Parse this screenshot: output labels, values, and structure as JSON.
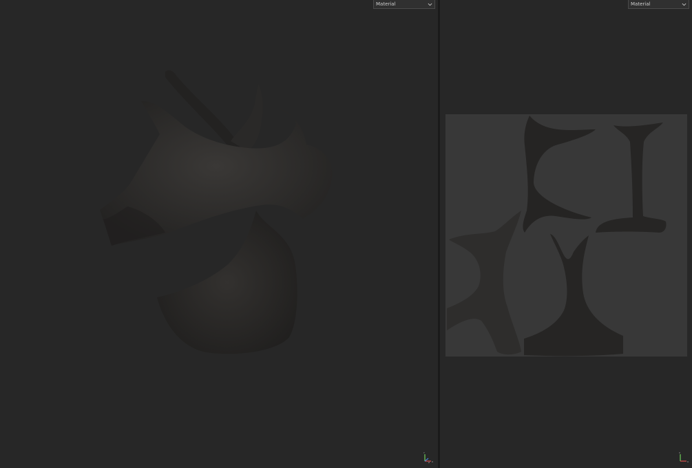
{
  "viewport_3d": {
    "shading_mode": "Material",
    "axis_labels": {
      "up": "Y",
      "right": "X",
      "depth": "Z"
    }
  },
  "viewport_uv": {
    "shading_mode": "Material",
    "axis_labels": {
      "up": "V",
      "right": "U"
    }
  },
  "icons": {
    "dropdown": "chevron-down-icon",
    "gizmo": "axis-gizmo-icon"
  },
  "colors": {
    "background": "#272727",
    "uv_tile": "#383838",
    "mesh": "#2b2a29",
    "axis_x": "#d9534f",
    "axis_y": "#6fcf5a",
    "axis_z": "#4a7fd9"
  }
}
